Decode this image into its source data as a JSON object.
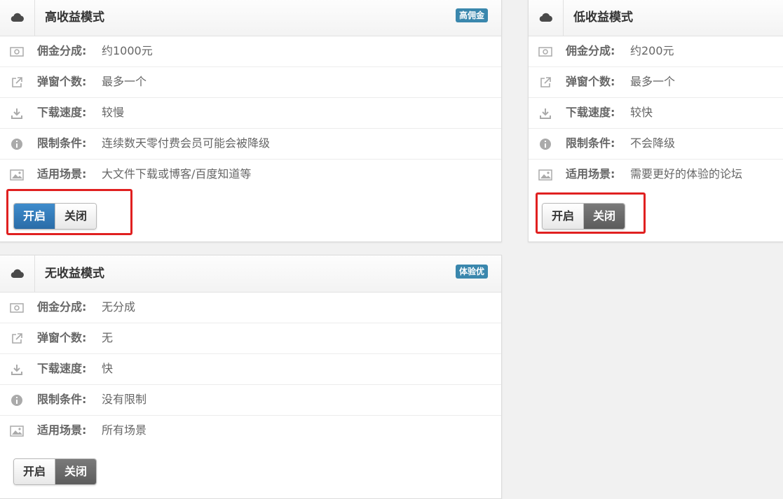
{
  "colors": {
    "badge": "#3a87ad",
    "on_active": "#2a6ca8",
    "off_active": "#5c5c5c",
    "highlight": "#e02020"
  },
  "labels": {
    "commission": "佣金分成:",
    "popups": "弹窗个数:",
    "speed": "下载速度:",
    "limit": "限制条件:",
    "scenario": "适用场景:"
  },
  "icons": [
    "money-icon",
    "external-link-icon",
    "download-icon",
    "info-icon",
    "image-icon"
  ],
  "cards": [
    {
      "title": "高收益模式",
      "badge": "高佣金",
      "values": [
        "约1000元",
        "最多一个",
        "较慢",
        "连续数天零付费会员可能会被降级",
        "大文件下载或博客/百度知道等"
      ],
      "toggle": {
        "on": "开启",
        "off": "关闭",
        "state": "on"
      }
    },
    {
      "title": "低收益模式",
      "badge": "",
      "values": [
        "约200元",
        "最多一个",
        "较快",
        "不会降级",
        "需要更好的体验的论坛"
      ],
      "toggle": {
        "on": "开启",
        "off": "关闭",
        "state": "off"
      }
    },
    {
      "title": "无收益模式",
      "badge": "体验优",
      "values": [
        "无分成",
        "无",
        "快",
        "没有限制",
        "所有场景"
      ],
      "toggle": {
        "on": "开启",
        "off": "关闭",
        "state": "off"
      }
    }
  ]
}
